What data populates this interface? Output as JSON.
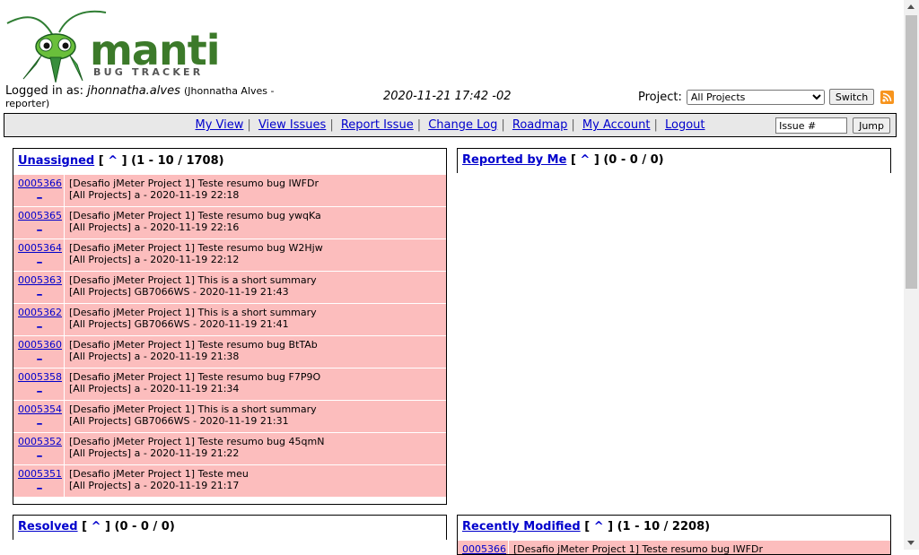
{
  "logo": {
    "word": "mantis",
    "tagline": "BUG TRACKER"
  },
  "header": {
    "logged_in_label": "Logged in as:",
    "username": "jhonnatha.alves",
    "user_detail": "(Jhonnatha Alves -",
    "user_role": "reporter)",
    "datetime": "2020-11-21 17:42 -02",
    "project_label": "Project:",
    "project_selected": "All Projects",
    "switch_label": "Switch",
    "rss_icon": "rss-icon"
  },
  "nav": {
    "links": [
      "My View",
      "View Issues",
      "Report Issue",
      "Change Log",
      "Roadmap",
      "My Account",
      "Logout"
    ],
    "separator": "|",
    "jump_placeholder": "Issue #",
    "jump_label": "Jump"
  },
  "boxes": {
    "unassigned": {
      "title": "Unassigned",
      "caret_open": "[",
      "caret": "^",
      "caret_close": "]",
      "count": "(1 - 10 / 1708)",
      "rows": [
        {
          "id": "0005366",
          "line1": "[Desafio jMeter Project 1] Teste resumo bug IWFDr",
          "line2": "[All Projects] a - 2020-11-19 22:18"
        },
        {
          "id": "0005365",
          "line1": "[Desafio jMeter Project 1] Teste resumo bug ywqKa",
          "line2": "[All Projects] a - 2020-11-19 22:16"
        },
        {
          "id": "0005364",
          "line1": "[Desafio jMeter Project 1] Teste resumo bug W2Hjw",
          "line2": "[All Projects] a - 2020-11-19 22:12"
        },
        {
          "id": "0005363",
          "line1": "[Desafio jMeter Project 1] This is a short summary",
          "line2": "[All Projects] GB7066WS - 2020-11-19 21:43"
        },
        {
          "id": "0005362",
          "line1": "[Desafio jMeter Project 1] This is a short summary",
          "line2": "[All Projects] GB7066WS - 2020-11-19 21:41"
        },
        {
          "id": "0005360",
          "line1": "[Desafio jMeter Project 1] Teste resumo bug BtTAb",
          "line2": "[All Projects] a - 2020-11-19 21:38"
        },
        {
          "id": "0005358",
          "line1": "[Desafio jMeter Project 1] Teste resumo bug F7P9O",
          "line2": "[All Projects] a - 2020-11-19 21:34"
        },
        {
          "id": "0005354",
          "line1": "[Desafio jMeter Project 1] This is a short summary",
          "line2": "[All Projects] GB7066WS - 2020-11-19 21:31"
        },
        {
          "id": "0005352",
          "line1": "[Desafio jMeter Project 1] Teste resumo bug 45qmN",
          "line2": "[All Projects] a - 2020-11-19 21:22"
        },
        {
          "id": "0005351",
          "line1": "[Desafio jMeter Project 1] Teste meu",
          "line2": "[All Projects] a - 2020-11-19 21:17"
        }
      ]
    },
    "reported": {
      "title": "Reported by Me",
      "count": "(0 - 0 / 0)"
    },
    "resolved": {
      "title": "Resolved",
      "count": "(0 - 0 / 0)"
    },
    "recent": {
      "title": "Recently Modified",
      "count": "(1 - 10 / 2208)",
      "first_row": {
        "id": "0005366",
        "line1": "[Desafio jMeter Project 1] Teste resumo bug IWFDr"
      }
    }
  },
  "colors": {
    "row_bg": "#fcbdbd",
    "link": "#0000cc",
    "navbar_bg": "#e8e8e8"
  }
}
